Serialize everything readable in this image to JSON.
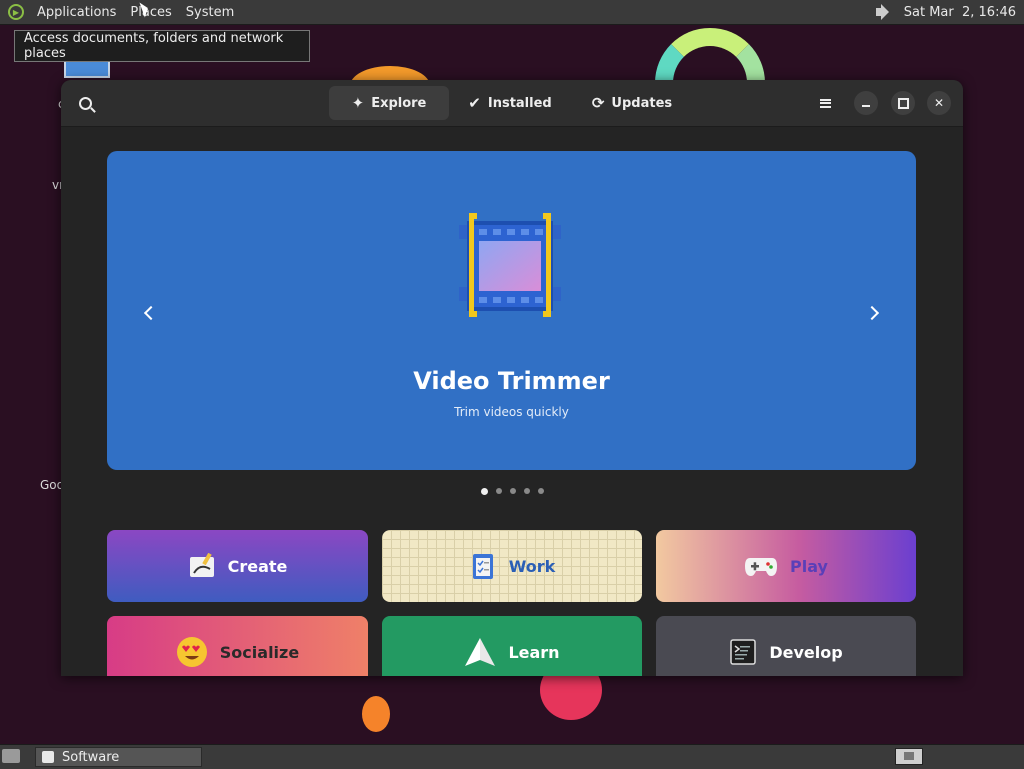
{
  "top_panel": {
    "menus": [
      "Applications",
      "Places",
      "System"
    ],
    "clock": "Sat Mar  2, 16:46"
  },
  "tooltip": "Access documents, folders and network places",
  "desktop": {
    "icon_labels": [
      "c",
      "vr",
      "Goo"
    ]
  },
  "software": {
    "tabs": [
      {
        "label": "Explore",
        "icon": "explore-icon"
      },
      {
        "label": "Installed",
        "icon": "check-circle-icon"
      },
      {
        "label": "Updates",
        "icon": "refresh-icon"
      }
    ],
    "banner": {
      "title": "Video Trimmer",
      "subtitle": "Trim videos quickly",
      "color": "#3170c5",
      "page_count": 5,
      "active_page": 1
    },
    "categories": [
      {
        "label": "Create",
        "icon": "create-icon"
      },
      {
        "label": "Work",
        "icon": "clipboard-icon"
      },
      {
        "label": "Play",
        "icon": "gamepad-icon"
      },
      {
        "label": "Socialize",
        "icon": "emoji-heart-eyes-icon"
      },
      {
        "label": "Learn",
        "icon": "paper-plane-icon"
      },
      {
        "label": "Develop",
        "icon": "terminal-icon"
      }
    ]
  },
  "taskbar": {
    "window_label": "Software"
  }
}
